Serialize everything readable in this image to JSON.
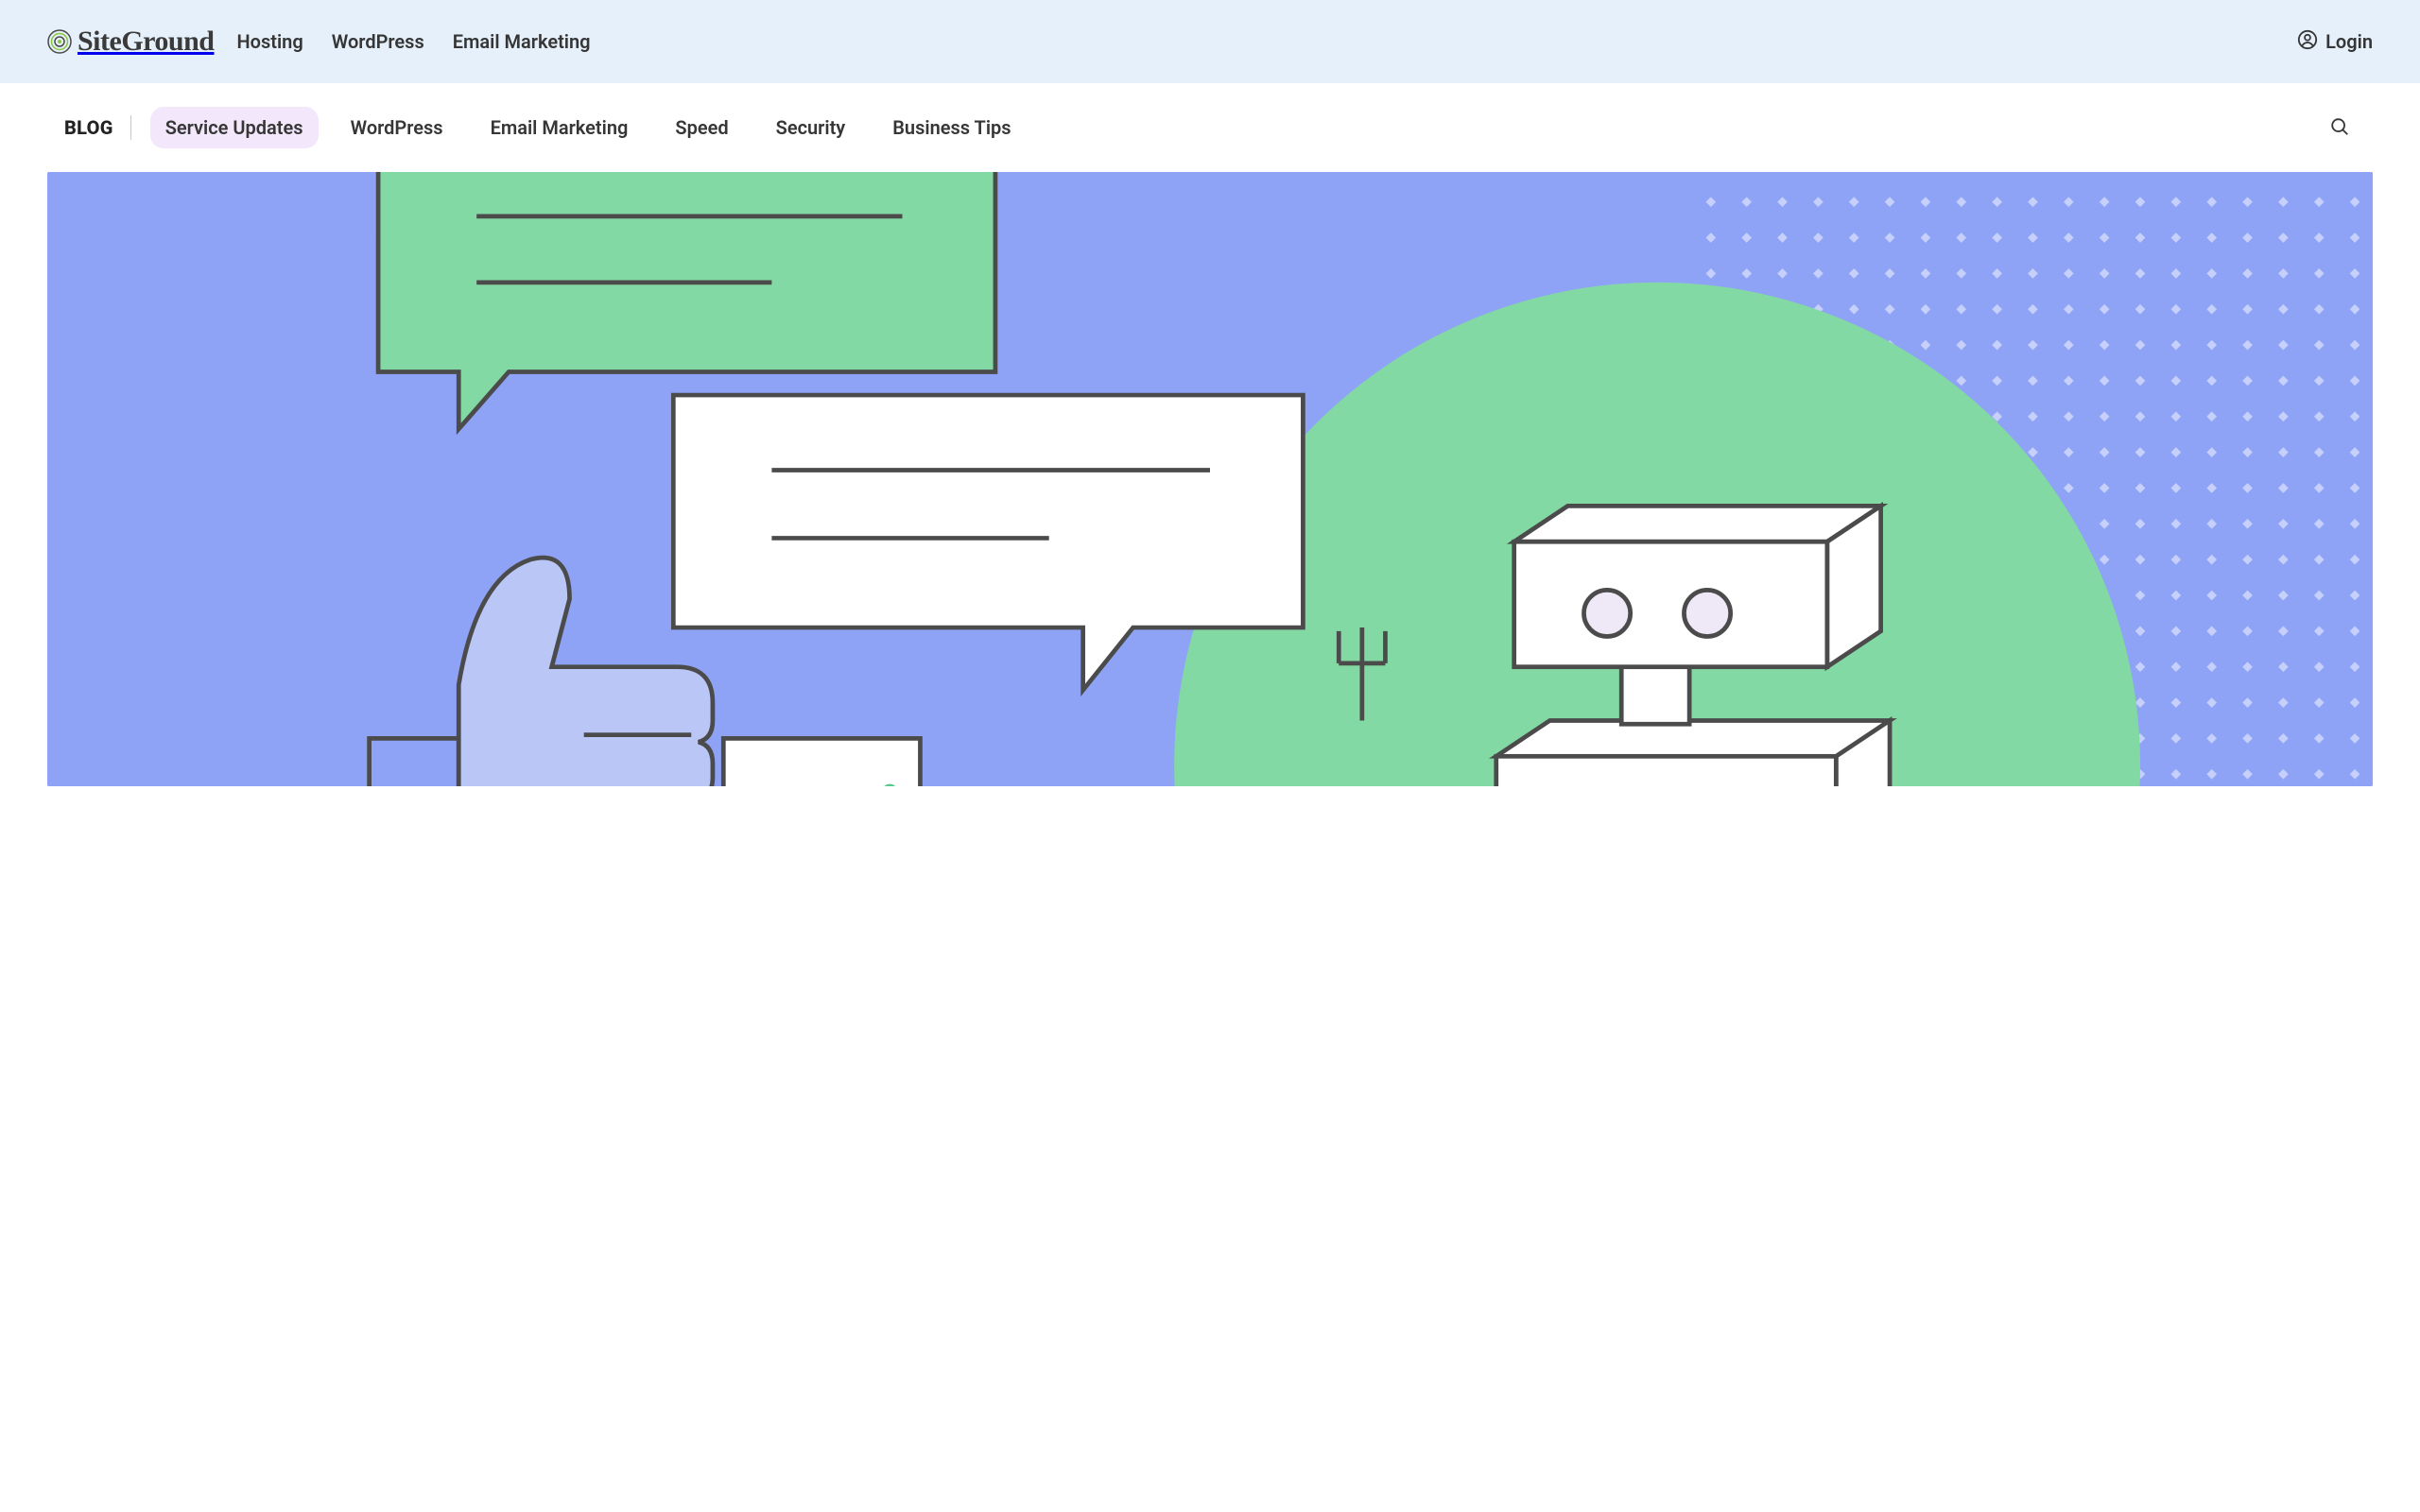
{
  "brand": "SiteGround",
  "topNav": {
    "items": [
      "Hosting",
      "WordPress",
      "Email Marketing"
    ],
    "login": "Login"
  },
  "subNav": {
    "label": "BLOG",
    "categories": [
      {
        "label": "Service Updates",
        "active": true
      },
      {
        "label": "WordPress",
        "active": false
      },
      {
        "label": "Email Marketing",
        "active": false
      },
      {
        "label": "Speed",
        "active": false
      },
      {
        "label": "Security",
        "active": false
      },
      {
        "label": "Business Tips",
        "active": false
      }
    ]
  },
  "colors": {
    "topbarBg": "#e6f0fa",
    "heroBg": "#8ea3f5",
    "heroCircle": "#83d9a3",
    "activePill": "#f3e7fb",
    "logoAccent": "#8cc63f"
  }
}
